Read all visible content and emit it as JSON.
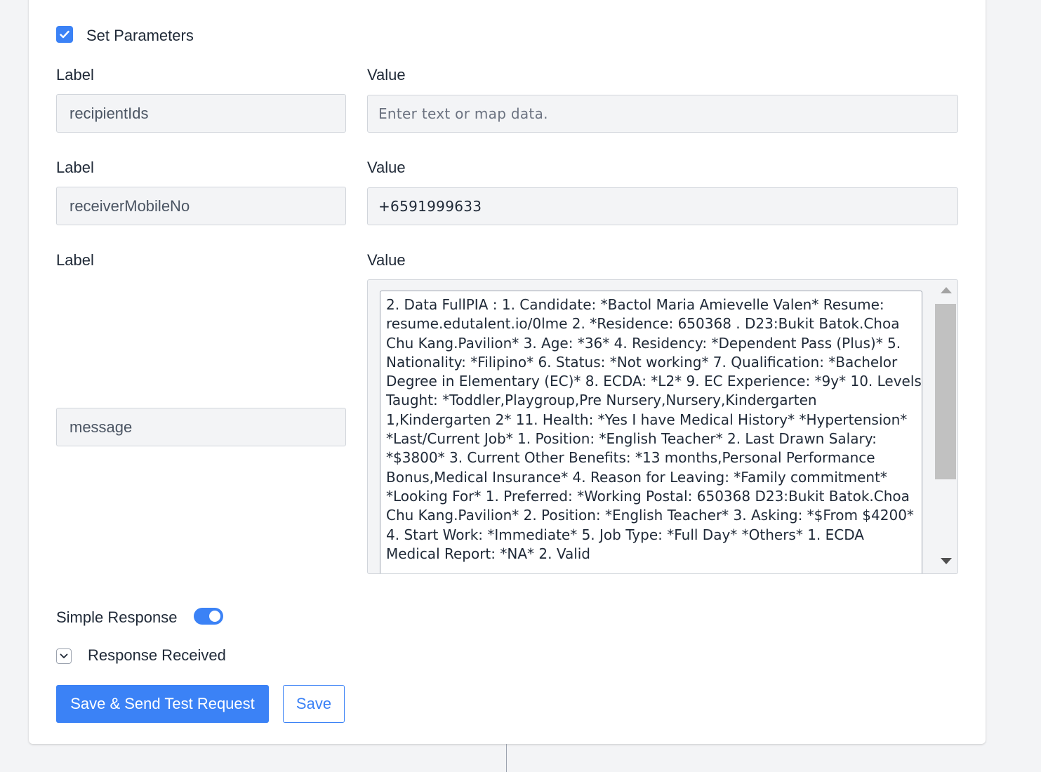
{
  "set_parameters": {
    "checked": true,
    "label": "Set Parameters"
  },
  "parameters": [
    {
      "label_heading": "Label",
      "value_heading": "Value",
      "label_value": "recipientIds",
      "value_value": "",
      "value_placeholder": "Enter text or map data."
    },
    {
      "label_heading": "Label",
      "value_heading": "Value",
      "label_value": "receiverMobileNo",
      "value_value": "+6591999633",
      "value_placeholder": ""
    },
    {
      "label_heading": "Label",
      "value_heading": "Value",
      "label_value": "message",
      "value_value": "2. Data FullPIA : 1. Candidate: *Bactol Maria Amievelle Valen* Resume: resume.edutalent.io/0lme 2. *Residence: 650368 . D23:Bukit Batok.Choa Chu Kang.Pavilion* 3. Age: *36* 4. Residency: *Dependent Pass (Plus)* 5. Nationality: *Filipino* 6. Status: *Not working* 7. Qualification: *Bachelor Degree in Elementary (EC)* 8. ECDA: *L2* 9. EC Experience: *9y* 10. Levels Taught: *Toddler,Playgroup,Pre Nursery,Nursery,Kindergarten 1,Kindergarten 2* 11. Health: *Yes I have Medical History* *Hypertension* *Last/Current Job* 1. Position: *English Teacher* 2. Last Drawn Salary: *$3800* 3. Current Other Benefits: *13 months,Personal Performance Bonus,Medical Insurance* 4. Reason for Leaving: *Family commitment* *Looking For* 1. Preferred: *Working Postal: 650368 D23:Bukit Batok.Choa Chu Kang.Pavilion* 2. Position: *English Teacher* 3. Asking: *$From $4200* 4. Start Work: *Immediate* 5. Job Type: *Full Day* *Others* 1. ECDA Medical Report: *NA* 2. Valid"
    }
  ],
  "simple_response": {
    "label": "Simple Response",
    "enabled": true
  },
  "response_received": {
    "label": "Response Received",
    "icon": "chevron-down-icon"
  },
  "buttons": {
    "save_send": "Save & Send Test Request",
    "save": "Save"
  },
  "colors": {
    "accent": "#3b82f6",
    "input_bg": "#f3f4f6",
    "border": "#d1d5db"
  }
}
